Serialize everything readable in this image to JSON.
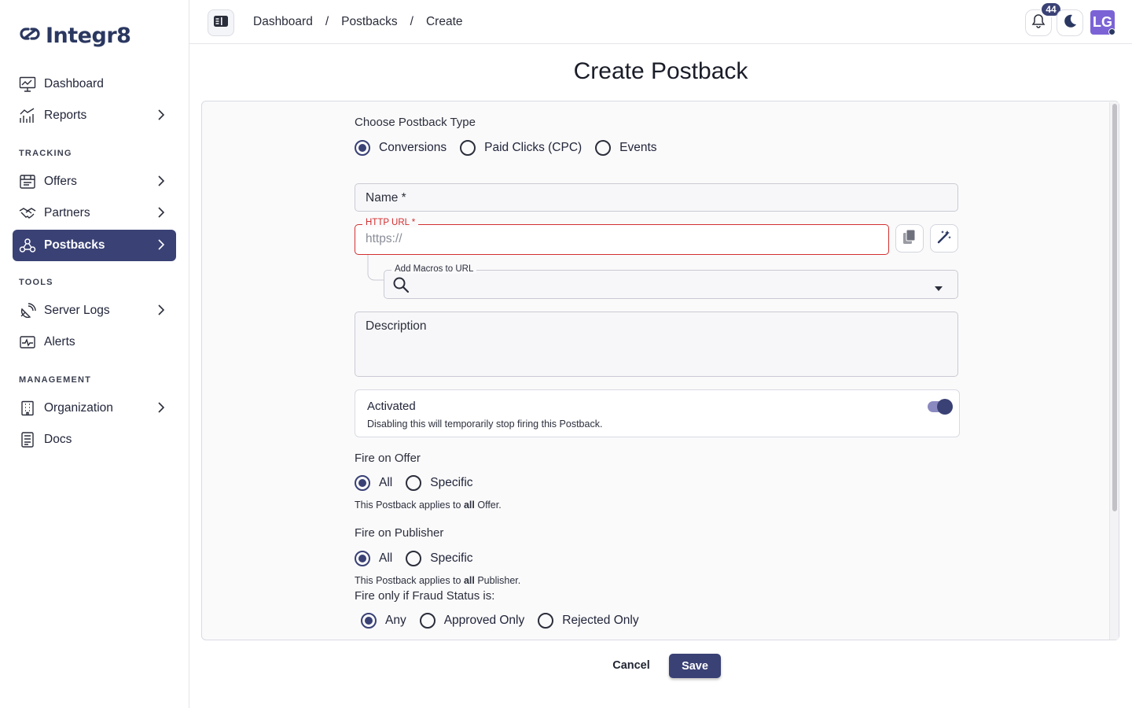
{
  "app": {
    "name": "Integr8"
  },
  "sidebar": {
    "items": [
      {
        "label": "Dashboard"
      },
      {
        "label": "Reports"
      },
      {
        "label": "Offers"
      },
      {
        "label": "Partners"
      },
      {
        "label": "Postbacks"
      },
      {
        "label": "Server Logs"
      },
      {
        "label": "Alerts"
      },
      {
        "label": "Organization"
      },
      {
        "label": "Docs"
      }
    ],
    "sections": {
      "tracking": "TRACKING",
      "tools": "TOOLS",
      "management": "MANAGEMENT"
    }
  },
  "header": {
    "breadcrumbs": [
      "Dashboard",
      "/",
      "Postbacks",
      "/",
      "Create"
    ],
    "notifications": "44",
    "avatar": "LG"
  },
  "page": {
    "title": "Create Postback"
  },
  "form": {
    "type_label": "Choose Postback Type",
    "type_options": [
      "Conversions",
      "Paid Clicks (CPC)",
      "Events"
    ],
    "type_selected": "Conversions",
    "name_label": "Name *",
    "http_label": "HTTP URL *",
    "http_placeholder": "https://",
    "macros_label": "Add Macros to URL",
    "description_label": "Description",
    "activated_title": "Activated",
    "activated_help": "Disabling this will temporarily stop firing this Postback.",
    "activated": true,
    "fire_offer_label": "Fire on Offer",
    "fire_offer_options": [
      "All",
      "Specific"
    ],
    "fire_offer_help_prefix": "This Postback applies to ",
    "fire_offer_help_bold": "all",
    "fire_offer_help_suffix": " Offer.",
    "fire_publisher_label": "Fire on Publisher",
    "fire_publisher_options": [
      "All",
      "Specific"
    ],
    "fire_publisher_help_prefix": "This Postback applies to ",
    "fire_publisher_help_bold": "all",
    "fire_publisher_help_suffix": " Publisher.",
    "fraud_label": "Fire only if Fraud Status is:",
    "fraud_options": [
      "Any",
      "Approved Only",
      "Rejected Only"
    ]
  },
  "actions": {
    "cancel": "Cancel",
    "save": "Save"
  },
  "colors": {
    "accent": "#3a4175",
    "error": "#d32f2f",
    "avatar": "#7b63d6"
  }
}
